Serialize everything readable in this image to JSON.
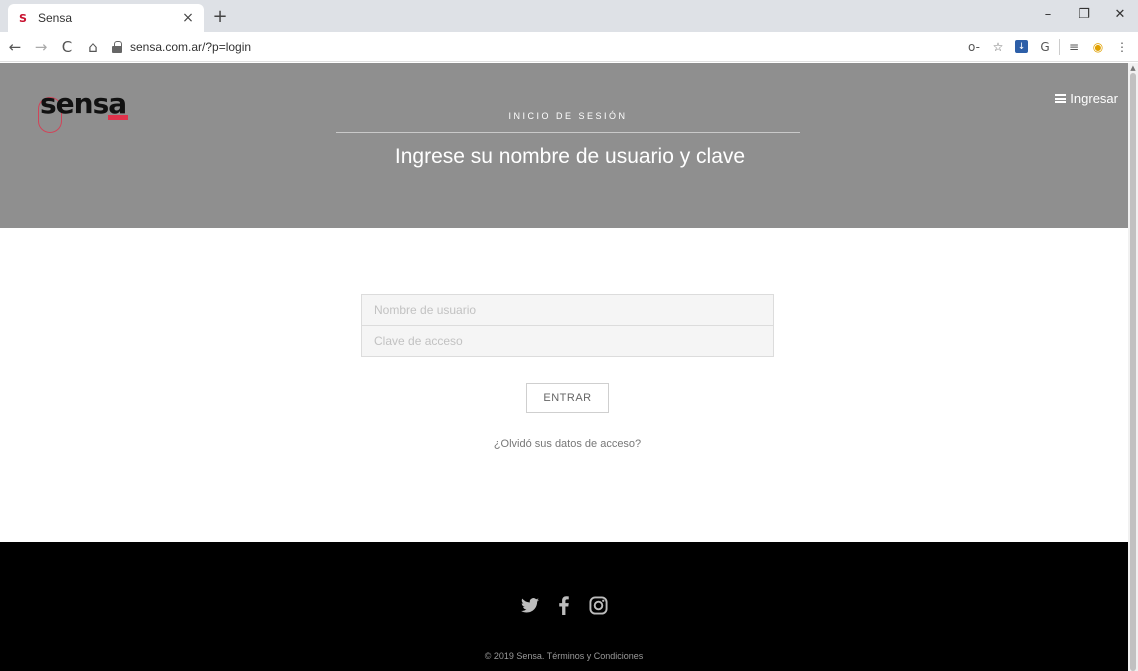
{
  "browser": {
    "tab_title": "Sensa",
    "favicon_letter": "S",
    "tab_close": "×",
    "new_tab": "+",
    "url": "sensa.com.ar/?p=login",
    "window_controls": {
      "minimize": "–",
      "restore": "❐",
      "close": "✕"
    },
    "nav": {
      "back": "←",
      "forward": "→",
      "reload": "C",
      "home": "⌂"
    },
    "toolbar_icons": {
      "key": "o-",
      "star": "☆",
      "pocket": "↓",
      "g": "G",
      "reading_list": "≡",
      "extension": "◉",
      "menu": "⋮"
    }
  },
  "header": {
    "logo_text": "sensa",
    "menu_label": "Ingresar",
    "section_label": "INICIO DE SESIÓN",
    "title": "Ingrese su nombre de usuario y clave"
  },
  "login": {
    "username_placeholder": "Nombre de usuario",
    "password_placeholder": "Clave de acceso",
    "submit_label": "ENTRAR",
    "forgot_label": "¿Olvidó sus datos de acceso?"
  },
  "footer": {
    "social": [
      "twitter-icon",
      "facebook-icon",
      "instagram-icon"
    ],
    "copyright": "© 2019 Sensa.",
    "terms_label": "Términos y Condiciones"
  },
  "colors": {
    "hero_bg": "#8f8f8f",
    "footer_bg": "#000000",
    "brand_red": "#e0324b"
  }
}
